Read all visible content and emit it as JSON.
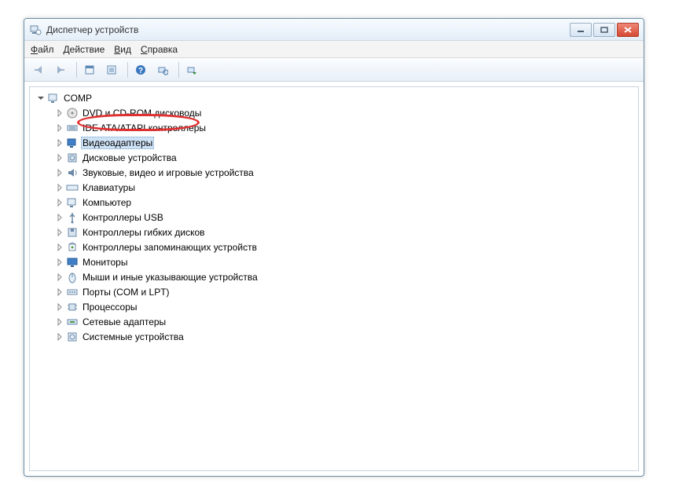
{
  "window": {
    "title": "Диспетчер устройств"
  },
  "menubar": {
    "file": "Файл",
    "action": "Действие",
    "view": "Вид",
    "help": "Справка"
  },
  "tree": {
    "root": "COMP",
    "items": [
      {
        "icon": "disc",
        "label": "DVD и CD-ROM дисководы"
      },
      {
        "icon": "ide",
        "label": "IDE ATA/ATAPI контроллеры"
      },
      {
        "icon": "display",
        "label": "Видеоадаптеры",
        "selected": true
      },
      {
        "icon": "disk",
        "label": "Дисковые устройства"
      },
      {
        "icon": "audio",
        "label": "Звуковые, видео и игровые устройства"
      },
      {
        "icon": "keyboard",
        "label": "Клавиатуры"
      },
      {
        "icon": "computer",
        "label": "Компьютер"
      },
      {
        "icon": "usb",
        "label": "Контроллеры USB"
      },
      {
        "icon": "floppy",
        "label": "Контроллеры гибких дисков"
      },
      {
        "icon": "storage",
        "label": "Контроллеры запоминающих устройств"
      },
      {
        "icon": "monitor",
        "label": "Мониторы"
      },
      {
        "icon": "mouse",
        "label": "Мыши и иные указывающие устройства"
      },
      {
        "icon": "port",
        "label": "Порты (COM и LPT)"
      },
      {
        "icon": "cpu",
        "label": "Процессоры"
      },
      {
        "icon": "network",
        "label": "Сетевые адаптеры"
      },
      {
        "icon": "system",
        "label": "Системные устройства"
      }
    ]
  }
}
